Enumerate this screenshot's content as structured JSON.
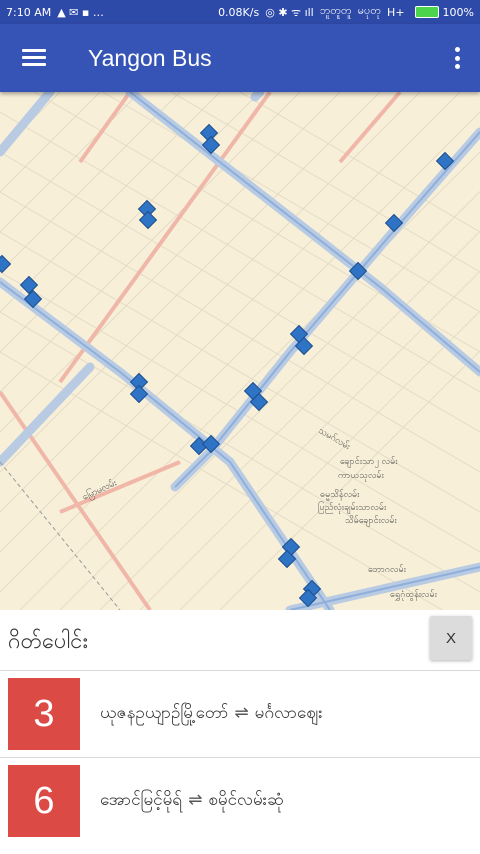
{
  "status_bar": {
    "time": "7:10 AM",
    "speed": "0.08K/s",
    "carrier1": "ဘူတူတူ",
    "carrier2": "မပုတု",
    "network": "H+",
    "battery": "100%"
  },
  "app_bar": {
    "title": "Yangon Bus"
  },
  "map": {
    "labels": [
      "သမဂ်လမ်း",
      "ချောင်းသာ၂ လမ်း",
      "ကာယသုလမ်း",
      "ဓမ္မသိန်လမ်း",
      "ပြည်လုံးချမ်းသာလမ်း",
      "သိမ်ချောင်းလမ်း",
      "မြောမလမ်း",
      "ဘောဂလမ်း",
      "ရွှေဂုံထွန်းလမ်း"
    ]
  },
  "panel": {
    "title": "ဂိတ်ပေါင်း",
    "close_label": "X",
    "routes": [
      {
        "number": "3",
        "from": "ယုဇနဥယျာဥ်မြို့တော်",
        "arrow": "⇌",
        "to": "မင်္ဂလာဈေး"
      },
      {
        "number": "6",
        "from": "အောင်မြင့်မိုရ်",
        "arrow": "⇌",
        "to": "စမိုင်လမ်းဆုံ"
      }
    ]
  }
}
